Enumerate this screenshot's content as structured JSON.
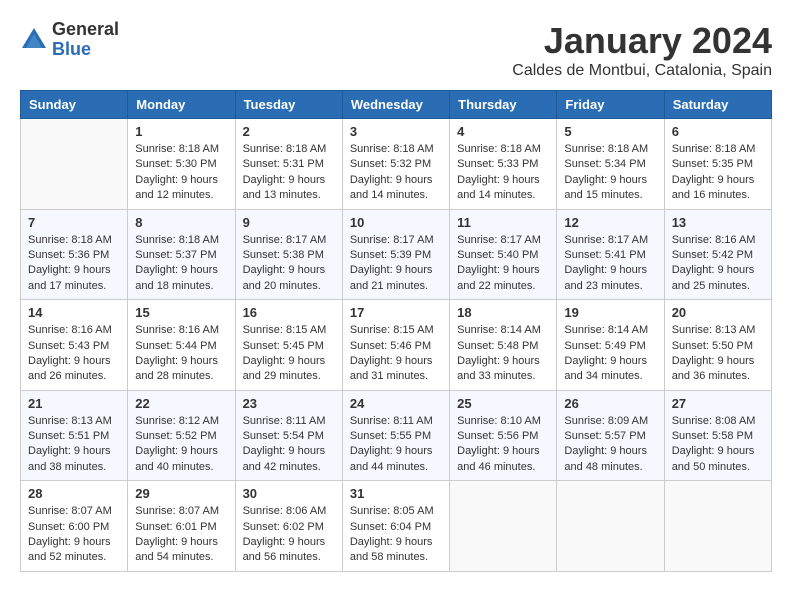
{
  "header": {
    "logo_general": "General",
    "logo_blue": "Blue",
    "month_title": "January 2024",
    "location": "Caldes de Montbui, Catalonia, Spain"
  },
  "days_of_week": [
    "Sunday",
    "Monday",
    "Tuesday",
    "Wednesday",
    "Thursday",
    "Friday",
    "Saturday"
  ],
  "weeks": [
    [
      {
        "day": "",
        "info": ""
      },
      {
        "day": "1",
        "info": "Sunrise: 8:18 AM\nSunset: 5:30 PM\nDaylight: 9 hours\nand 12 minutes."
      },
      {
        "day": "2",
        "info": "Sunrise: 8:18 AM\nSunset: 5:31 PM\nDaylight: 9 hours\nand 13 minutes."
      },
      {
        "day": "3",
        "info": "Sunrise: 8:18 AM\nSunset: 5:32 PM\nDaylight: 9 hours\nand 14 minutes."
      },
      {
        "day": "4",
        "info": "Sunrise: 8:18 AM\nSunset: 5:33 PM\nDaylight: 9 hours\nand 14 minutes."
      },
      {
        "day": "5",
        "info": "Sunrise: 8:18 AM\nSunset: 5:34 PM\nDaylight: 9 hours\nand 15 minutes."
      },
      {
        "day": "6",
        "info": "Sunrise: 8:18 AM\nSunset: 5:35 PM\nDaylight: 9 hours\nand 16 minutes."
      }
    ],
    [
      {
        "day": "7",
        "info": "Sunrise: 8:18 AM\nSunset: 5:36 PM\nDaylight: 9 hours\nand 17 minutes."
      },
      {
        "day": "8",
        "info": "Sunrise: 8:18 AM\nSunset: 5:37 PM\nDaylight: 9 hours\nand 18 minutes."
      },
      {
        "day": "9",
        "info": "Sunrise: 8:17 AM\nSunset: 5:38 PM\nDaylight: 9 hours\nand 20 minutes."
      },
      {
        "day": "10",
        "info": "Sunrise: 8:17 AM\nSunset: 5:39 PM\nDaylight: 9 hours\nand 21 minutes."
      },
      {
        "day": "11",
        "info": "Sunrise: 8:17 AM\nSunset: 5:40 PM\nDaylight: 9 hours\nand 22 minutes."
      },
      {
        "day": "12",
        "info": "Sunrise: 8:17 AM\nSunset: 5:41 PM\nDaylight: 9 hours\nand 23 minutes."
      },
      {
        "day": "13",
        "info": "Sunrise: 8:16 AM\nSunset: 5:42 PM\nDaylight: 9 hours\nand 25 minutes."
      }
    ],
    [
      {
        "day": "14",
        "info": "Sunrise: 8:16 AM\nSunset: 5:43 PM\nDaylight: 9 hours\nand 26 minutes."
      },
      {
        "day": "15",
        "info": "Sunrise: 8:16 AM\nSunset: 5:44 PM\nDaylight: 9 hours\nand 28 minutes."
      },
      {
        "day": "16",
        "info": "Sunrise: 8:15 AM\nSunset: 5:45 PM\nDaylight: 9 hours\nand 29 minutes."
      },
      {
        "day": "17",
        "info": "Sunrise: 8:15 AM\nSunset: 5:46 PM\nDaylight: 9 hours\nand 31 minutes."
      },
      {
        "day": "18",
        "info": "Sunrise: 8:14 AM\nSunset: 5:48 PM\nDaylight: 9 hours\nand 33 minutes."
      },
      {
        "day": "19",
        "info": "Sunrise: 8:14 AM\nSunset: 5:49 PM\nDaylight: 9 hours\nand 34 minutes."
      },
      {
        "day": "20",
        "info": "Sunrise: 8:13 AM\nSunset: 5:50 PM\nDaylight: 9 hours\nand 36 minutes."
      }
    ],
    [
      {
        "day": "21",
        "info": "Sunrise: 8:13 AM\nSunset: 5:51 PM\nDaylight: 9 hours\nand 38 minutes."
      },
      {
        "day": "22",
        "info": "Sunrise: 8:12 AM\nSunset: 5:52 PM\nDaylight: 9 hours\nand 40 minutes."
      },
      {
        "day": "23",
        "info": "Sunrise: 8:11 AM\nSunset: 5:54 PM\nDaylight: 9 hours\nand 42 minutes."
      },
      {
        "day": "24",
        "info": "Sunrise: 8:11 AM\nSunset: 5:55 PM\nDaylight: 9 hours\nand 44 minutes."
      },
      {
        "day": "25",
        "info": "Sunrise: 8:10 AM\nSunset: 5:56 PM\nDaylight: 9 hours\nand 46 minutes."
      },
      {
        "day": "26",
        "info": "Sunrise: 8:09 AM\nSunset: 5:57 PM\nDaylight: 9 hours\nand 48 minutes."
      },
      {
        "day": "27",
        "info": "Sunrise: 8:08 AM\nSunset: 5:58 PM\nDaylight: 9 hours\nand 50 minutes."
      }
    ],
    [
      {
        "day": "28",
        "info": "Sunrise: 8:07 AM\nSunset: 6:00 PM\nDaylight: 9 hours\nand 52 minutes."
      },
      {
        "day": "29",
        "info": "Sunrise: 8:07 AM\nSunset: 6:01 PM\nDaylight: 9 hours\nand 54 minutes."
      },
      {
        "day": "30",
        "info": "Sunrise: 8:06 AM\nSunset: 6:02 PM\nDaylight: 9 hours\nand 56 minutes."
      },
      {
        "day": "31",
        "info": "Sunrise: 8:05 AM\nSunset: 6:04 PM\nDaylight: 9 hours\nand 58 minutes."
      },
      {
        "day": "",
        "info": ""
      },
      {
        "day": "",
        "info": ""
      },
      {
        "day": "",
        "info": ""
      }
    ]
  ]
}
